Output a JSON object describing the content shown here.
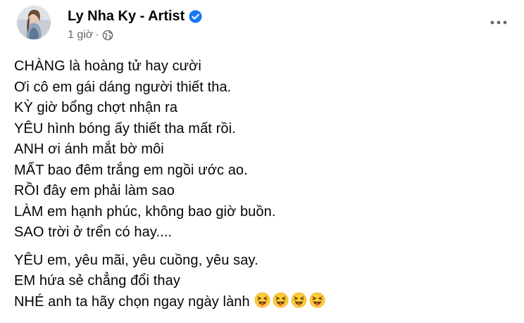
{
  "post": {
    "author": "Ly Nha Ky - Artist",
    "time": "1 giờ",
    "separator": "·",
    "audience_icon": "globe-icon",
    "verified_icon": "verified-badge-icon",
    "more_icon": "more-options-icon"
  },
  "colors": {
    "verified": "#1877f2",
    "meta": "#65676b",
    "text": "#050505"
  },
  "content": {
    "stanza1": [
      "CHÀNG là hoàng tử hay cười",
      "Ơi cô em gái dáng người thiết tha.",
      "KỲ giờ bổng chợt nhận ra",
      "YÊU hình bóng ấy thiết tha mất rồi.",
      "ANH ơi ánh mắt bờ môi",
      "MẤT bao đêm trắng em ngồi ước ao.",
      "RỒI đây em phải làm sao",
      "LÀM em hạnh phúc, không bao giờ buồn.",
      "SAO trời ở trển có hay...."
    ],
    "stanza2": [
      "YÊU em, yêu mãi, yêu cuồng, yêu say.",
      "EM hứa sẻ chẳng đổi thay",
      "NHÉ anh ta hãy chọn ngay ngày lành"
    ],
    "emoji_name": "squinting-face-with-tongue-icon",
    "emoji_count": 4
  }
}
